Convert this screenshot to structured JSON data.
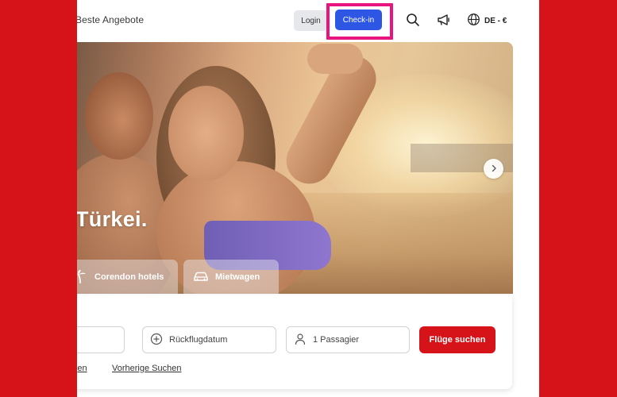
{
  "header": {
    "nav_link": "Beste Angebote",
    "login_label": "Login",
    "checkin_label": "Check-in",
    "language_label": "DE - €",
    "icons": [
      "search-icon",
      "megaphone-icon",
      "globe-icon"
    ]
  },
  "hero": {
    "title": "Türkei.",
    "tabs": [
      {
        "label": "Corendon hotels",
        "icon": "palm-tree-icon"
      },
      {
        "label": "Mietwagen",
        "icon": "car-icon"
      }
    ]
  },
  "search": {
    "return_placeholder": "Rückflugdatum",
    "passengers": "1 Passagier",
    "submit_label": "Flüge suchen",
    "link_partial": "ungen",
    "link_previous": "Vorherige Suchen"
  },
  "colors": {
    "brand_red": "#d51318",
    "checkin_blue": "#2d56e4",
    "highlight_pink": "#e8157f"
  }
}
